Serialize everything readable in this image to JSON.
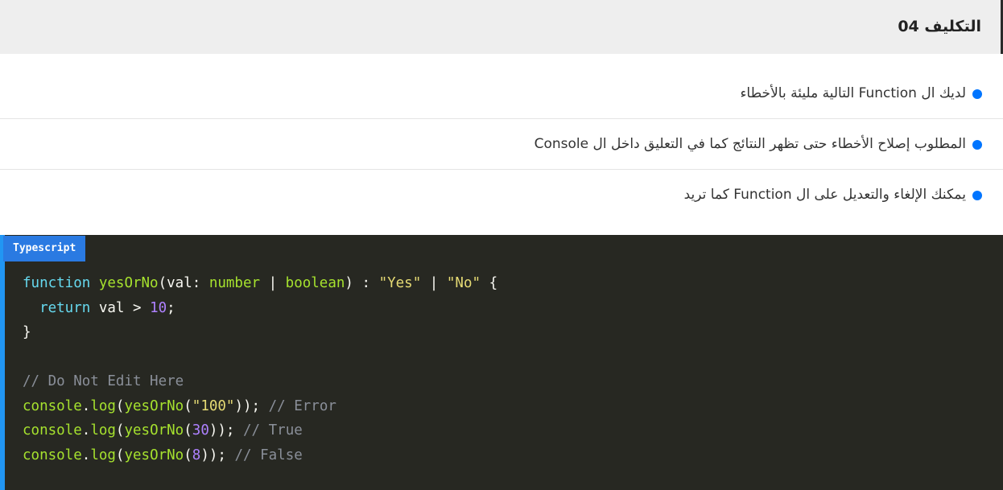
{
  "header": {
    "title": "التكليف 04"
  },
  "instructions": [
    "لديك ال Function التالية مليئة بالأخطاء",
    "المطلوب إصلاح الأخطاء حتى تظهر النتائج كما في التعليق داخل ال Console",
    "يمكنك الإلغاء والتعديل على ال Function كما تريد"
  ],
  "colors": {
    "bullet": "#0075ff",
    "code_background": "#272822",
    "accent": "#2a7ae2"
  },
  "code_block": {
    "language": "Typescript",
    "lines": [
      [
        {
          "t": "kw",
          "v": "function"
        },
        {
          "t": "pl",
          "v": " "
        },
        {
          "t": "fn",
          "v": "yesOrNo"
        },
        {
          "t": "pl",
          "v": "(val: "
        },
        {
          "t": "typ",
          "v": "number"
        },
        {
          "t": "pl",
          "v": " | "
        },
        {
          "t": "typ",
          "v": "boolean"
        },
        {
          "t": "pl",
          "v": ") : "
        },
        {
          "t": "str",
          "v": "\"Yes\""
        },
        {
          "t": "pl",
          "v": " | "
        },
        {
          "t": "str",
          "v": "\"No\""
        },
        {
          "t": "pl",
          "v": " {"
        }
      ],
      [
        {
          "t": "pl",
          "v": "  "
        },
        {
          "t": "kw",
          "v": "return"
        },
        {
          "t": "pl",
          "v": " val > "
        },
        {
          "t": "num",
          "v": "10"
        },
        {
          "t": "pl",
          "v": ";"
        }
      ],
      [
        {
          "t": "pl",
          "v": "}"
        }
      ],
      [],
      [
        {
          "t": "cmt",
          "v": "// Do Not Edit Here"
        }
      ],
      [
        {
          "t": "fn",
          "v": "console"
        },
        {
          "t": "pl",
          "v": "."
        },
        {
          "t": "fn",
          "v": "log"
        },
        {
          "t": "pl",
          "v": "("
        },
        {
          "t": "fn",
          "v": "yesOrNo"
        },
        {
          "t": "pl",
          "v": "("
        },
        {
          "t": "str",
          "v": "\"100\""
        },
        {
          "t": "pl",
          "v": ")); "
        },
        {
          "t": "cmt",
          "v": "// Error"
        }
      ],
      [
        {
          "t": "fn",
          "v": "console"
        },
        {
          "t": "pl",
          "v": "."
        },
        {
          "t": "fn",
          "v": "log"
        },
        {
          "t": "pl",
          "v": "("
        },
        {
          "t": "fn",
          "v": "yesOrNo"
        },
        {
          "t": "pl",
          "v": "("
        },
        {
          "t": "num",
          "v": "30"
        },
        {
          "t": "pl",
          "v": ")); "
        },
        {
          "t": "cmt",
          "v": "// True"
        }
      ],
      [
        {
          "t": "fn",
          "v": "console"
        },
        {
          "t": "pl",
          "v": "."
        },
        {
          "t": "fn",
          "v": "log"
        },
        {
          "t": "pl",
          "v": "("
        },
        {
          "t": "fn",
          "v": "yesOrNo"
        },
        {
          "t": "pl",
          "v": "("
        },
        {
          "t": "num",
          "v": "8"
        },
        {
          "t": "pl",
          "v": ")); "
        },
        {
          "t": "cmt",
          "v": "// False"
        }
      ]
    ]
  }
}
